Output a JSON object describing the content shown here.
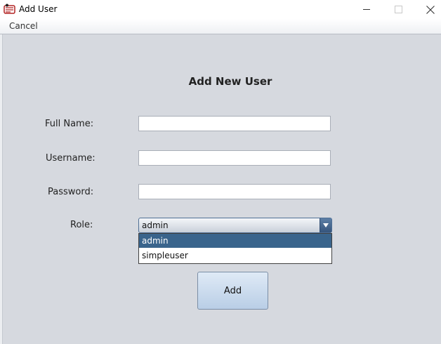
{
  "window": {
    "title": "Add User",
    "icon": "app-logo-icon"
  },
  "menubar": {
    "items": [
      {
        "label": "Cancel"
      }
    ]
  },
  "form": {
    "heading": "Add New User",
    "fields": {
      "full_name": {
        "label": "Full Name:",
        "value": ""
      },
      "username": {
        "label": "Username:",
        "value": ""
      },
      "password": {
        "label": "Password:",
        "value": ""
      }
    },
    "role": {
      "label": "Role:",
      "selected": "admin",
      "options": [
        "admin",
        "simpleuser"
      ],
      "highlighted_option": "admin"
    },
    "submit_label": "Add"
  },
  "colors": {
    "background": "#d6d9df",
    "selection": "#39648c",
    "button": "#c8daee"
  }
}
